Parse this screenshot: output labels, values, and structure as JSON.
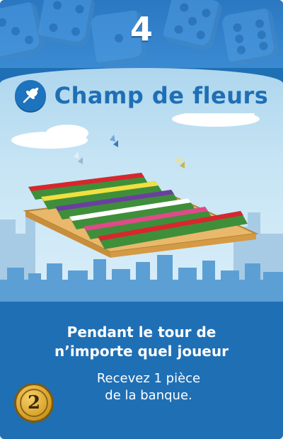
{
  "card": {
    "activation_number": "4",
    "title": "Champ de fleurs",
    "effect_header_lines": [
      "Pendant le tour de",
      "n’importe quel joueur"
    ],
    "effect_body_lines": [
      "Recevez 1 pièce",
      "de la banque."
    ],
    "cost": "2"
  },
  "icons": {
    "type_icon": "wheat-icon",
    "coin_icon": "coin-icon"
  },
  "colors": {
    "card_blue": "#1f6fb5",
    "title_blue": "#1f6fb5",
    "sky": "#c6e4f4",
    "coin_gold": "#d9a32b"
  }
}
